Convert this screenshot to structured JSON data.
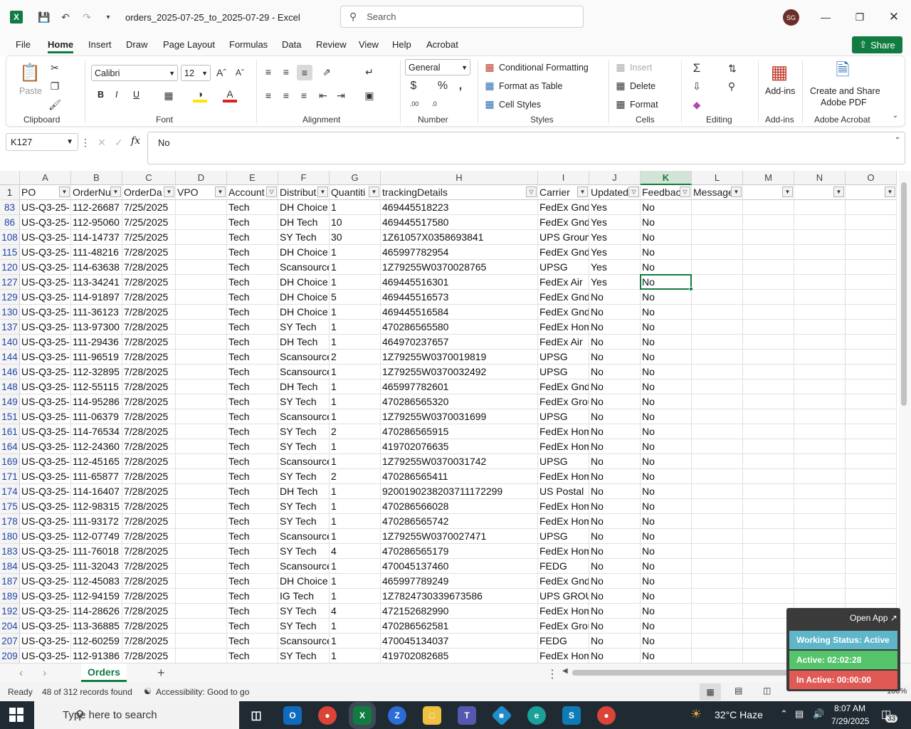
{
  "window": {
    "title": "orders_2025-07-25_to_2025-07-29  -  Excel",
    "search_placeholder": "Search",
    "user_initials": "SG"
  },
  "menu": [
    "File",
    "Home",
    "Insert",
    "Draw",
    "Page Layout",
    "Formulas",
    "Data",
    "Review",
    "View",
    "Help",
    "Acrobat"
  ],
  "share_label": "Share",
  "ribbon": {
    "clipboard": {
      "paste": "Paste",
      "label": "Clipboard"
    },
    "font": {
      "name": "Calibri",
      "size": "12",
      "bold": "B",
      "italic": "I",
      "underline": "U",
      "label": "Font"
    },
    "alignment": {
      "label": "Alignment"
    },
    "number": {
      "format": "General",
      "label": "Number"
    },
    "styles": {
      "conditional": "Conditional Formatting",
      "format_table": "Format as Table",
      "cell_styles": "Cell Styles",
      "label": "Styles"
    },
    "cells": {
      "insert": "Insert",
      "delete": "Delete",
      "format": "Format",
      "label": "Cells"
    },
    "editing": {
      "label": "Editing"
    },
    "addins": {
      "btn": "Add-ins",
      "label": "Add-ins"
    },
    "acrobat": {
      "btn1": "Create and Share",
      "btn2": "Adobe PDF",
      "label": "Adobe Acrobat"
    }
  },
  "formula": {
    "name_box": "K127",
    "value": "No",
    "fx": "fx"
  },
  "columns": [
    "A",
    "B",
    "C",
    "D",
    "E",
    "F",
    "G",
    "H",
    "I",
    "J",
    "K",
    "L",
    "M",
    "N",
    "O"
  ],
  "selected_column": "K",
  "header_row": {
    "row": "1",
    "cells": [
      "PO",
      "OrderNu",
      "OrderDa",
      "VPO",
      "Account",
      "Distribut",
      "Quantiti",
      "trackingDetails",
      "Carrier",
      "Updated",
      "Feedbac",
      "Message",
      "",
      "",
      ""
    ]
  },
  "filtered_columns": [
    "E",
    "H",
    "J",
    "K"
  ],
  "rows": [
    {
      "n": "83",
      "c": [
        "US-Q3-25-",
        "112-26687",
        "7/25/2025",
        "",
        "Tech",
        "DH Choice",
        "1",
        "469445518223",
        "FedEx Gnd",
        "Yes",
        "No"
      ]
    },
    {
      "n": "86",
      "c": [
        "US-Q3-25-",
        "112-95060",
        "7/25/2025",
        "",
        "Tech",
        "DH Tech",
        "10",
        "469445517580",
        "FedEx Gnd",
        "Yes",
        "No"
      ]
    },
    {
      "n": "108",
      "c": [
        "US-Q3-25-",
        "114-14737",
        "7/25/2025",
        "",
        "Tech",
        "SY Tech",
        "30",
        "1Z61057X0358693841",
        "UPS Groun",
        "Yes",
        "No"
      ]
    },
    {
      "n": "115",
      "c": [
        "US-Q3-25-",
        "111-48216",
        "7/28/2025",
        "",
        "Tech",
        "DH Choice",
        "1",
        "465997782954",
        "FedEx Gnd",
        "Yes",
        "No"
      ]
    },
    {
      "n": "120",
      "c": [
        "US-Q3-25-",
        "114-63638",
        "7/28/2025",
        "",
        "Tech",
        "Scansource",
        "1",
        "1Z79255W0370028765",
        "UPSG",
        "Yes",
        "No"
      ]
    },
    {
      "n": "127",
      "c": [
        "US-Q3-25-",
        "113-34241",
        "7/28/2025",
        "",
        "Tech",
        "DH Choice",
        "1",
        "469445516301",
        "FedEx Air",
        "Yes",
        "No"
      ]
    },
    {
      "n": "129",
      "c": [
        "US-Q3-25-",
        "114-91897",
        "7/28/2025",
        "",
        "Tech",
        "DH Choice",
        "5",
        "469445516573",
        "FedEx Gnd",
        "No",
        "No"
      ]
    },
    {
      "n": "130",
      "c": [
        "US-Q3-25-",
        "111-36123",
        "7/28/2025",
        "",
        "Tech",
        "DH Choice",
        "1",
        "469445516584",
        "FedEx Gnd",
        "No",
        "No"
      ]
    },
    {
      "n": "137",
      "c": [
        "US-Q3-25-",
        "113-97300",
        "7/28/2025",
        "",
        "Tech",
        "SY Tech",
        "1",
        "470286565580",
        "FedEx Hom",
        "No",
        "No"
      ]
    },
    {
      "n": "140",
      "c": [
        "US-Q3-25-",
        "111-29436",
        "7/28/2025",
        "",
        "Tech",
        "DH Tech",
        "1",
        "464970237657",
        "FedEx Air",
        "No",
        "No"
      ]
    },
    {
      "n": "144",
      "c": [
        "US-Q3-25-",
        "111-96519",
        "7/28/2025",
        "",
        "Tech",
        "Scansource",
        "2",
        "1Z79255W0370019819",
        "UPSG",
        "No",
        "No"
      ]
    },
    {
      "n": "146",
      "c": [
        "US-Q3-25-",
        "112-32895",
        "7/28/2025",
        "",
        "Tech",
        "Scansource",
        "1",
        "1Z79255W0370032492",
        "UPSG",
        "No",
        "No"
      ]
    },
    {
      "n": "148",
      "c": [
        "US-Q3-25-",
        "112-55115",
        "7/28/2025",
        "",
        "Tech",
        "DH Tech",
        "1",
        "465997782601",
        "FedEx Gnd",
        "No",
        "No"
      ]
    },
    {
      "n": "149",
      "c": [
        "US-Q3-25-",
        "114-95286",
        "7/28/2025",
        "",
        "Tech",
        "SY Tech",
        "1",
        "470286565320",
        "FedEx Grou",
        "No",
        "No"
      ]
    },
    {
      "n": "151",
      "c": [
        "US-Q3-25-",
        "111-06379",
        "7/28/2025",
        "",
        "Tech",
        "Scansource",
        "1",
        "1Z79255W0370031699",
        "UPSG",
        "No",
        "No"
      ]
    },
    {
      "n": "161",
      "c": [
        "US-Q3-25-",
        "114-76534",
        "7/28/2025",
        "",
        "Tech",
        "SY Tech",
        "2",
        "470286565915",
        "FedEx Hom",
        "No",
        "No"
      ]
    },
    {
      "n": "164",
      "c": [
        "US-Q3-25-",
        "112-24360",
        "7/28/2025",
        "",
        "Tech",
        "SY Tech",
        "1",
        "419702076635",
        "FedEx Hom",
        "No",
        "No"
      ]
    },
    {
      "n": "169",
      "c": [
        "US-Q3-25-",
        "112-45165",
        "7/28/2025",
        "",
        "Tech",
        "Scansource",
        "1",
        "1Z79255W0370031742",
        "UPSG",
        "No",
        "No"
      ]
    },
    {
      "n": "171",
      "c": [
        "US-Q3-25-",
        "111-65877",
        "7/28/2025",
        "",
        "Tech",
        "SY Tech",
        "2",
        "470286565411",
        "FedEx Hom",
        "No",
        "No"
      ]
    },
    {
      "n": "174",
      "c": [
        "US-Q3-25-",
        "114-16407",
        "7/28/2025",
        "",
        "Tech",
        "DH Tech",
        "1",
        "9200190238203711172299",
        "US Postal",
        "No",
        "No"
      ]
    },
    {
      "n": "175",
      "c": [
        "US-Q3-25-",
        "112-98315",
        "7/28/2025",
        "",
        "Tech",
        "SY Tech",
        "1",
        "470286566028",
        "FedEx Hom",
        "No",
        "No"
      ]
    },
    {
      "n": "178",
      "c": [
        "US-Q3-25-",
        "111-93172",
        "7/28/2025",
        "",
        "Tech",
        "SY Tech",
        "1",
        "470286565742",
        "FedEx Hom",
        "No",
        "No"
      ]
    },
    {
      "n": "180",
      "c": [
        "US-Q3-25-",
        "112-07749",
        "7/28/2025",
        "",
        "Tech",
        "Scansource",
        "1",
        "1Z79255W0370027471",
        "UPSG",
        "No",
        "No"
      ]
    },
    {
      "n": "183",
      "c": [
        "US-Q3-25-",
        "111-76018",
        "7/28/2025",
        "",
        "Tech",
        "SY Tech",
        "4",
        "470286565179",
        "FedEx Hom",
        "No",
        "No"
      ]
    },
    {
      "n": "184",
      "c": [
        "US-Q3-25-",
        "111-32043",
        "7/28/2025",
        "",
        "Tech",
        "Scansource",
        "1",
        "470045137460",
        "FEDG",
        "No",
        "No"
      ]
    },
    {
      "n": "187",
      "c": [
        "US-Q3-25-",
        "112-45083",
        "7/28/2025",
        "",
        "Tech",
        "DH Choice",
        "1",
        "465997789249",
        "FedEx Gnd",
        "No",
        "No"
      ]
    },
    {
      "n": "189",
      "c": [
        "US-Q3-25-",
        "112-94159",
        "7/28/2025",
        "",
        "Tech",
        "IG Tech",
        "1",
        "1Z7824730339673586",
        "UPS GROU",
        "No",
        "No"
      ]
    },
    {
      "n": "192",
      "c": [
        "US-Q3-25-",
        "114-28626",
        "7/28/2025",
        "",
        "Tech",
        "SY Tech",
        "4",
        "472152682990",
        "FedEx Hom",
        "No",
        "No"
      ]
    },
    {
      "n": "204",
      "c": [
        "US-Q3-25-",
        "113-36885",
        "7/28/2025",
        "",
        "Tech",
        "SY Tech",
        "1",
        "470286562581",
        "FedEx Grou",
        "No",
        "No"
      ]
    },
    {
      "n": "207",
      "c": [
        "US-Q3-25-",
        "112-60259",
        "7/28/2025",
        "",
        "Tech",
        "Scansource",
        "1",
        "470045134037",
        "FEDG",
        "No",
        "No"
      ]
    },
    {
      "n": "209",
      "c": [
        "US-Q3-25-",
        "112-91386",
        "7/28/2025",
        "",
        "Tech",
        "SY Tech",
        "1",
        "419702082685",
        "FedEx Hom",
        "No",
        "No"
      ]
    }
  ],
  "selected_cell": {
    "row": "127",
    "col": "K"
  },
  "sheet_tab": "Orders",
  "status": {
    "ready": "Ready",
    "records": "48 of 312 records found",
    "accessibility": "Accessibility: Good to go",
    "zoom": "100%"
  },
  "widget": {
    "open_app": "Open App ↗",
    "working": "Working Status: Active",
    "active": "Active: 02:02:28",
    "inactive": "In Active: 00:00:00"
  },
  "taskbar": {
    "search_placeholder": "Type here to search",
    "weather": "32°C  Haze",
    "time": "8:07 AM",
    "date": "7/29/2025",
    "notifications": "33"
  },
  "colors": {
    "excel_green": "#107c41",
    "active_green": "#55c46b",
    "inactive_red": "#e05a55",
    "working_teal": "#5fb6c9"
  }
}
